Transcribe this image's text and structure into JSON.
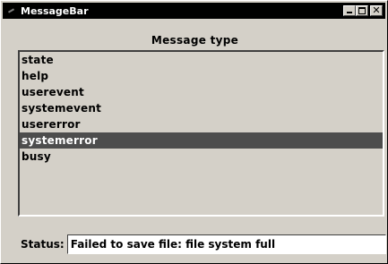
{
  "window": {
    "title": "MessageBar",
    "icon": "app-icon",
    "controls": {
      "minimize": "minimize",
      "maximize": "maximize",
      "close": "✕"
    }
  },
  "main": {
    "heading": "Message type",
    "list": {
      "items": [
        {
          "label": "state"
        },
        {
          "label": "help"
        },
        {
          "label": "userevent"
        },
        {
          "label": "systemevent"
        },
        {
          "label": "usererror"
        },
        {
          "label": "systemerror"
        },
        {
          "label": "busy"
        }
      ],
      "selected_index": 5
    }
  },
  "status": {
    "label": "Status:",
    "value": "Failed to save file: file system full"
  },
  "colors": {
    "background": "#d4d0c8",
    "titlebar": "#000000",
    "selection": "#4d4d4d",
    "selection_text": "#ffffff",
    "field_background": "#ffffff"
  }
}
